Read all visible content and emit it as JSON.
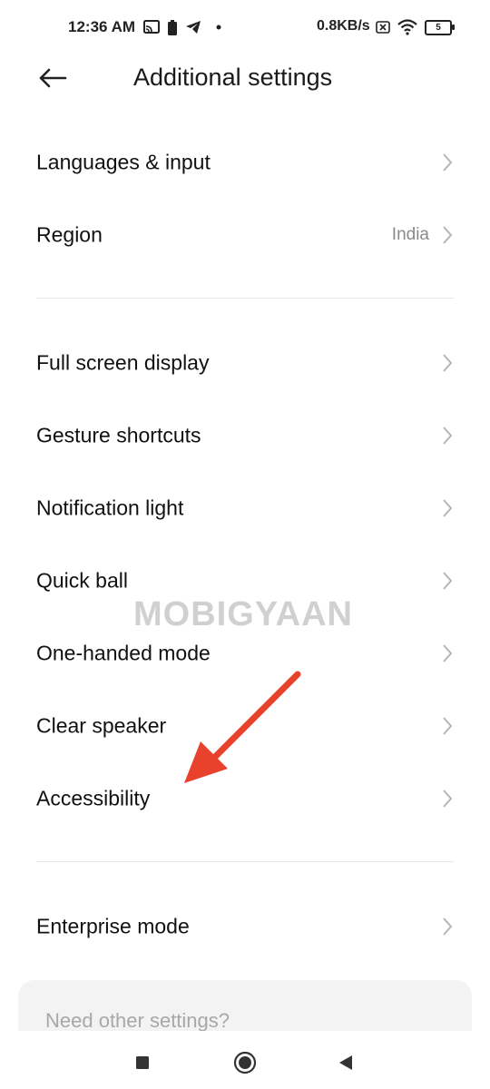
{
  "status_bar": {
    "time": "12:36 AM",
    "speed": "0.8KB/s",
    "battery": "5",
    "icons": [
      "cast-icon",
      "battery-saver-icon",
      "telegram-icon",
      "dot-icon",
      "sim-x-icon",
      "wifi-icon",
      "battery-icon"
    ]
  },
  "header": {
    "title": "Additional settings",
    "back_icon": "back-arrow-icon"
  },
  "groups": [
    {
      "items": [
        {
          "label": "Languages & input",
          "value": ""
        },
        {
          "label": "Region",
          "value": "India"
        }
      ]
    },
    {
      "items": [
        {
          "label": "Full screen display",
          "value": ""
        },
        {
          "label": "Gesture shortcuts",
          "value": ""
        },
        {
          "label": "Notification light",
          "value": ""
        },
        {
          "label": "Quick ball",
          "value": ""
        },
        {
          "label": "One-handed mode",
          "value": ""
        },
        {
          "label": "Clear speaker",
          "value": ""
        },
        {
          "label": "Accessibility",
          "value": ""
        }
      ]
    },
    {
      "items": [
        {
          "label": "Enterprise mode",
          "value": ""
        }
      ]
    }
  ],
  "watermark": "MOBIGYAAN",
  "card": {
    "text": "Need other settings?"
  },
  "nav": {
    "icons": [
      "recent-apps-icon",
      "home-icon",
      "back-icon"
    ]
  },
  "colors": {
    "arrow": "#e8412c",
    "background": "#ffffff",
    "value_text": "#8a8a8a"
  }
}
